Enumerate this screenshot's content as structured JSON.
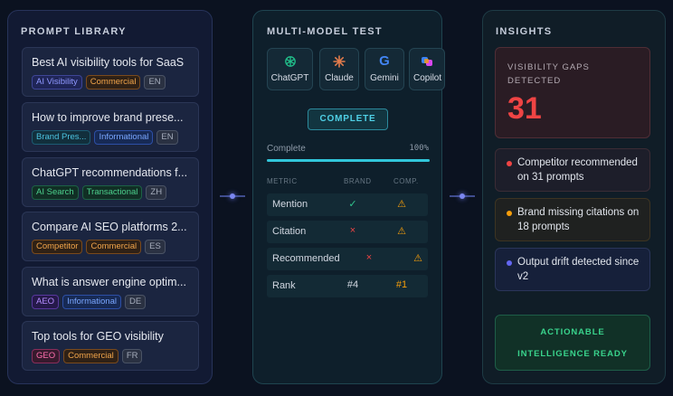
{
  "library": {
    "title": "PROMPT LIBRARY",
    "prompts": [
      {
        "title": "Best AI visibility tools for SaaS",
        "tags": [
          "AI Visibility",
          "Commercial"
        ],
        "lang": "EN"
      },
      {
        "title": "How to improve brand prese...",
        "tags": [
          "Brand Pres...",
          "Informational"
        ],
        "lang": "EN"
      },
      {
        "title": "ChatGPT recommendations f...",
        "tags": [
          "AI Search",
          "Transactional"
        ],
        "lang": "ZH"
      },
      {
        "title": "Compare AI SEO platforms 2...",
        "tags": [
          "Competitor",
          "Commercial"
        ],
        "lang": "ES"
      },
      {
        "title": "What is answer engine optim...",
        "tags": [
          "AEO",
          "Informational"
        ],
        "lang": "DE"
      },
      {
        "title": "Top tools for GEO visibility",
        "tags": [
          "GEO",
          "Commercial"
        ],
        "lang": "FR"
      }
    ]
  },
  "test": {
    "title": "MULTI-MODEL TEST",
    "models": [
      {
        "label": "ChatGPT",
        "icon": "openai-icon"
      },
      {
        "label": "Claude",
        "icon": "claude-icon"
      },
      {
        "label": "Gemini",
        "icon": "google-icon"
      },
      {
        "label": "Copilot",
        "icon": "copilot-icon"
      }
    ],
    "status_button": "COMPLETE",
    "progress_label": "Complete",
    "progress_value": "100%",
    "progress": 1.0,
    "table_headers": [
      "METRIC",
      "BRAND",
      "COMP."
    ],
    "metrics": [
      {
        "name": "Mention",
        "brand": "✓",
        "comp": "⚠"
      },
      {
        "name": "Citation",
        "brand": "×",
        "comp": "⚠"
      },
      {
        "name": "Recommended",
        "brand": "×",
        "comp": "⚠"
      },
      {
        "name": "Rank",
        "brand": "#4",
        "comp": "#1"
      }
    ]
  },
  "insights": {
    "title": "INSIGHTS",
    "gaps_label": "VISIBILITY GAPS DETECTED",
    "gaps_count": "31",
    "items": [
      {
        "text": "Competitor recommended on 31 prompts",
        "color": "#ef4444"
      },
      {
        "text": "Brand missing citations on 18 prompts",
        "color": "#f59e0b"
      },
      {
        "text": "Output drift detected since v2",
        "color": "#6366f1"
      }
    ],
    "action_line1": "ACTIONABLE",
    "action_line2": "INTELLIGENCE READY"
  },
  "colors": {
    "accent": "#31c6da",
    "danger": "#ef4444",
    "warning": "#f59e0b",
    "success": "#39d38c"
  }
}
